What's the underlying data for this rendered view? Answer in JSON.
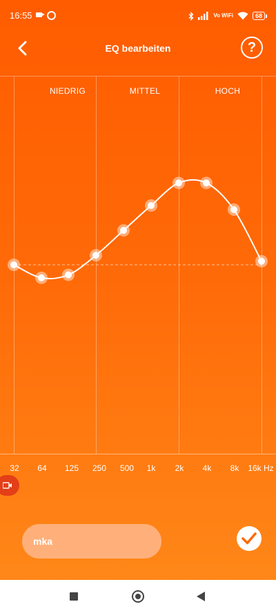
{
  "status_bar": {
    "time": "16:55",
    "network": "Vo WiFi",
    "battery": "68",
    "icons": [
      "video-camera-icon",
      "circle-notification-icon",
      "bluetooth-icon",
      "signal-icon",
      "wifi-icon",
      "battery-icon"
    ]
  },
  "toolbar": {
    "title": "EQ bearbeiten",
    "back_icon": "chevron-left-icon",
    "help_label": "?"
  },
  "bands": {
    "low": "NIEDRIG",
    "mid": "MITTEL",
    "high": "HOCH"
  },
  "frequencies": [
    "32",
    "64",
    "125",
    "250",
    "500",
    "1k",
    "2k",
    "4k",
    "8k",
    "16k Hz"
  ],
  "eq_gain_levels": [
    0.0,
    -0.22,
    -0.17,
    0.16,
    0.58,
    1.0,
    1.38,
    1.38,
    0.93,
    0.06
  ],
  "preset": {
    "name": "mka"
  },
  "confirm_icon": "checkmark-icon",
  "record_icon": "video-record-icon",
  "colors": {
    "background_top": "#ff5c00",
    "background_bottom": "#ff8a1a",
    "accent": "#ff6a00",
    "curve": "#ffffff"
  }
}
